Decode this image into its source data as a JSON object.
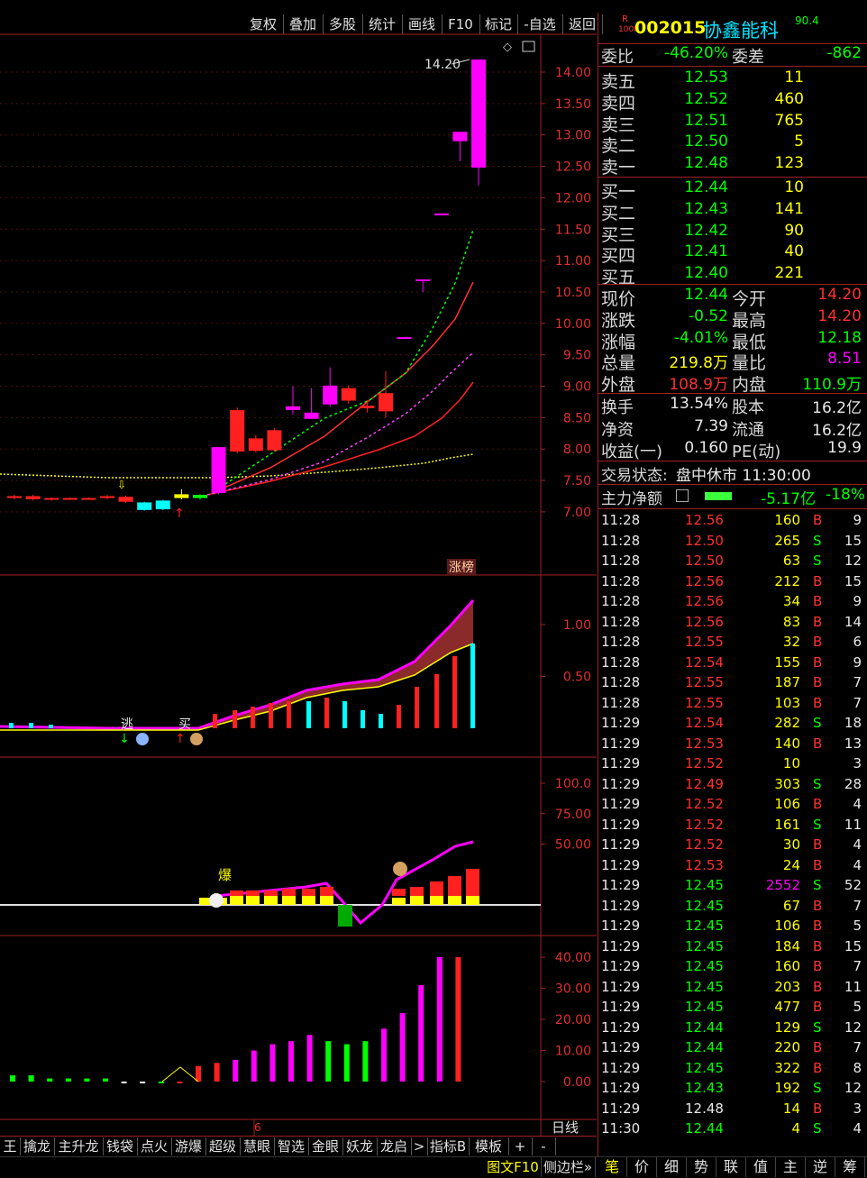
{
  "toolbar": {
    "buttons": [
      "复权",
      "叠加",
      "多股",
      "统计",
      "画线",
      "F10",
      "标记",
      "-自选",
      "返回"
    ]
  },
  "stock": {
    "badge_top": "R",
    "badge_bottom": "1000",
    "code": "002015",
    "name": "协鑫能科",
    "score": "90.4"
  },
  "weibi": {
    "label1": "委比",
    "val1": "-46.20%",
    "label2": "委差",
    "val2": "-862"
  },
  "sell": [
    {
      "label": "卖五",
      "price": "12.53",
      "vol": "11"
    },
    {
      "label": "卖四",
      "price": "12.52",
      "vol": "460"
    },
    {
      "label": "卖三",
      "price": "12.51",
      "vol": "765"
    },
    {
      "label": "卖二",
      "price": "12.50",
      "vol": "5"
    },
    {
      "label": "卖一",
      "price": "12.48",
      "vol": "123"
    }
  ],
  "buy": [
    {
      "label": "买一",
      "price": "12.44",
      "vol": "10"
    },
    {
      "label": "买二",
      "price": "12.43",
      "vol": "141"
    },
    {
      "label": "买三",
      "price": "12.42",
      "vol": "90"
    },
    {
      "label": "买四",
      "price": "12.41",
      "vol": "40"
    },
    {
      "label": "买五",
      "price": "12.40",
      "vol": "221"
    }
  ],
  "stats": [
    {
      "l1": "现价",
      "v1": "12.44",
      "c1": "#00ff00",
      "l2": "今开",
      "v2": "14.20",
      "c2": "#ff3030"
    },
    {
      "l1": "涨跌",
      "v1": "-0.52",
      "c1": "#00ff00",
      "l2": "最高",
      "v2": "14.20",
      "c2": "#ff3030"
    },
    {
      "l1": "涨幅",
      "v1": "-4.01%",
      "c1": "#00ff00",
      "l2": "最低",
      "v2": "12.18",
      "c2": "#00ff00"
    },
    {
      "l1": "总量",
      "v1": "219.8万",
      "c1": "#ffff00",
      "l2": "量比",
      "v2": "8.51",
      "c2": "#ff00ff"
    },
    {
      "l1": "外盘",
      "v1": "108.9万",
      "c1": "#ff3030",
      "l2": "内盘",
      "v2": "110.9万",
      "c2": "#00ff00"
    }
  ],
  "stats2": [
    {
      "l1": "换手",
      "v1": "13.54%",
      "l2": "股本",
      "v2": "16.2亿"
    },
    {
      "l1": "净资",
      "v1": "7.39",
      "l2": "流通",
      "v2": "16.2亿"
    },
    {
      "l1": "收益(一)",
      "v1": "0.160",
      "l2": "PE(动)",
      "v2": "19.9"
    }
  ],
  "trade_status": {
    "label": "交易状态:",
    "value": "盘中休市 11:30:00"
  },
  "main_net": {
    "label": "主力净额",
    "value": "-5.17亿",
    "pct": "-18%"
  },
  "ticks": [
    [
      "11:28",
      "12.56",
      "160",
      "B",
      "9"
    ],
    [
      "11:28",
      "12.50",
      "265",
      "S",
      "15"
    ],
    [
      "11:28",
      "12.50",
      "63",
      "S",
      "12"
    ],
    [
      "11:28",
      "12.56",
      "212",
      "B",
      "15"
    ],
    [
      "11:28",
      "12.56",
      "34",
      "B",
      "9"
    ],
    [
      "11:28",
      "12.56",
      "83",
      "B",
      "14"
    ],
    [
      "11:28",
      "12.55",
      "32",
      "B",
      "6"
    ],
    [
      "11:28",
      "12.54",
      "155",
      "B",
      "9"
    ],
    [
      "11:28",
      "12.55",
      "187",
      "B",
      "7"
    ],
    [
      "11:28",
      "12.55",
      "103",
      "B",
      "7"
    ],
    [
      "11:29",
      "12.54",
      "282",
      "S",
      "18"
    ],
    [
      "11:29",
      "12.53",
      "140",
      "B",
      "13"
    ],
    [
      "11:29",
      "12.52",
      "10",
      "",
      "3"
    ],
    [
      "11:29",
      "12.49",
      "303",
      "S",
      "28"
    ],
    [
      "11:29",
      "12.52",
      "106",
      "B",
      "4"
    ],
    [
      "11:29",
      "12.52",
      "161",
      "S",
      "11"
    ],
    [
      "11:29",
      "12.52",
      "30",
      "B",
      "4"
    ],
    [
      "11:29",
      "12.53",
      "24",
      "B",
      "4"
    ],
    [
      "11:29",
      "12.45",
      "2552",
      "S",
      "52"
    ],
    [
      "11:29",
      "12.45",
      "67",
      "B",
      "7"
    ],
    [
      "11:29",
      "12.45",
      "106",
      "B",
      "5"
    ],
    [
      "11:29",
      "12.45",
      "184",
      "B",
      "15"
    ],
    [
      "11:29",
      "12.45",
      "160",
      "B",
      "7"
    ],
    [
      "11:29",
      "12.45",
      "203",
      "B",
      "11"
    ],
    [
      "11:29",
      "12.45",
      "477",
      "B",
      "5"
    ],
    [
      "11:29",
      "12.44",
      "129",
      "S",
      "12"
    ],
    [
      "11:29",
      "12.44",
      "220",
      "B",
      "7"
    ],
    [
      "11:29",
      "12.45",
      "322",
      "B",
      "8"
    ],
    [
      "11:29",
      "12.43",
      "192",
      "S",
      "12"
    ],
    [
      "11:29",
      "12.48",
      "14",
      "B",
      "3"
    ],
    [
      "11:30",
      "12.44",
      "4",
      "S",
      "4"
    ]
  ],
  "bottom_tabs": [
    "王",
    "擒龙",
    "主升龙",
    "钱袋",
    "点火",
    "游爆",
    "超级",
    "慧眼",
    "智选",
    "金眼",
    "妖龙",
    "龙启",
    ">",
    "指标B",
    "模板",
    "+",
    "-"
  ],
  "footer_left": [
    "图文F10",
    "侧边栏»"
  ],
  "footer_right": [
    "笔",
    "价",
    "细",
    "势",
    "联",
    "值",
    "主",
    "逆",
    "筹"
  ],
  "chart_labels": {
    "price_axis": [
      "14.00",
      "13.50",
      "13.00",
      "12.50",
      "12.00",
      "11.50",
      "11.00",
      "10.50",
      "10.00",
      "9.50",
      "9.00",
      "8.50",
      "8.00",
      "7.50",
      "7.00"
    ],
    "ind1_axis": [
      "1.00",
      "0.50"
    ],
    "ind2_axis": [
      "100.0",
      "75.00",
      "50.00"
    ],
    "ind3_axis": [
      "40.00",
      "30.00",
      "20.00",
      "10.00",
      "0.00"
    ],
    "high_marker": "14.20",
    "zhangbang": "涨榜",
    "tao": "逃",
    "mai": "买",
    "bao": "爆",
    "x_label": "6",
    "period": "日线"
  },
  "chart_data": [
    {
      "type": "candlestick",
      "ylim": [
        6.75,
        14.3
      ],
      "candles": [
        {
          "o": 7.22,
          "c": 7.25,
          "h": 7.27,
          "l": 7.2,
          "color": "red"
        },
        {
          "o": 7.25,
          "c": 7.2,
          "h": 7.27,
          "l": 7.18,
          "color": "red"
        },
        {
          "o": 7.22,
          "c": 7.2,
          "h": 7.23,
          "l": 7.18,
          "color": "red"
        },
        {
          "o": 7.22,
          "c": 7.2,
          "h": 7.23,
          "l": 7.19,
          "color": "red"
        },
        {
          "o": 7.22,
          "c": 7.21,
          "h": 7.23,
          "l": 7.19,
          "color": "red"
        },
        {
          "o": 7.25,
          "c": 7.22,
          "h": 7.27,
          "l": 7.2,
          "color": "red"
        },
        {
          "o": 7.24,
          "c": 7.16,
          "h": 7.26,
          "l": 7.14,
          "color": "red"
        },
        {
          "o": 7.15,
          "c": 7.03,
          "h": 7.16,
          "l": 7.02,
          "color": "cyan"
        },
        {
          "o": 7.18,
          "c": 7.04,
          "h": 7.19,
          "l": 7.03,
          "color": "cyan"
        },
        {
          "o": 7.22,
          "c": 7.28,
          "h": 7.36,
          "l": 7.2,
          "color": "yellow"
        },
        {
          "o": 7.22,
          "c": 7.27,
          "h": 7.28,
          "l": 7.2,
          "color": "green"
        },
        {
          "o": 7.3,
          "c": 8.03,
          "h": 8.03,
          "l": 7.28,
          "color": "magenta"
        },
        {
          "o": 8.62,
          "c": 7.96,
          "h": 8.66,
          "l": 7.93,
          "color": "red"
        },
        {
          "o": 8.17,
          "c": 7.97,
          "h": 8.22,
          "l": 7.95,
          "color": "red"
        },
        {
          "o": 8.3,
          "c": 7.98,
          "h": 8.33,
          "l": 7.96,
          "color": "red"
        },
        {
          "o": 8.62,
          "c": 8.68,
          "h": 9.0,
          "l": 8.55,
          "color": "magenta"
        },
        {
          "o": 8.48,
          "c": 8.58,
          "h": 8.97,
          "l": 8.5,
          "color": "magenta"
        },
        {
          "o": 8.71,
          "c": 9.01,
          "h": 9.3,
          "l": 8.67,
          "color": "magenta"
        },
        {
          "o": 8.97,
          "c": 8.77,
          "h": 9.02,
          "l": 8.72,
          "color": "red"
        },
        {
          "o": 8.69,
          "c": 8.65,
          "h": 8.78,
          "l": 8.58,
          "color": "red"
        },
        {
          "o": 8.89,
          "c": 8.6,
          "h": 9.24,
          "l": 8.5,
          "color": "red"
        },
        {
          "o": 9.78,
          "c": 9.78,
          "h": 9.78,
          "l": 9.78,
          "color": "magenta"
        },
        {
          "o": 10.7,
          "c": 10.7,
          "h": 10.7,
          "l": 10.5,
          "color": "magenta"
        },
        {
          "o": 11.75,
          "c": 11.75,
          "h": 11.75,
          "l": 11.75,
          "color": "magenta"
        },
        {
          "o": 12.9,
          "c": 13.05,
          "h": 13.05,
          "l": 12.58,
          "color": "magenta"
        },
        {
          "o": 12.48,
          "c": 14.2,
          "h": 14.2,
          "l": 12.2,
          "color": "magenta"
        }
      ]
    },
    {
      "type": "bar",
      "title": "",
      "ylim": [
        0,
        40
      ],
      "values": [
        2,
        2,
        1,
        1,
        1,
        1,
        -0.3,
        -0.3,
        0,
        0,
        5,
        6,
        7,
        10,
        12,
        13,
        15,
        13,
        12,
        13,
        17,
        22,
        31,
        40,
        40
      ],
      "colors": [
        "green",
        "green",
        "green",
        "green",
        "green",
        "green",
        "white",
        "white",
        "green",
        "red",
        "red",
        "red",
        "magenta",
        "magenta",
        "magenta",
        "magenta",
        "magenta",
        "green",
        "green",
        "green",
        "magenta",
        "magenta",
        "magenta",
        "magenta",
        "red"
      ]
    }
  ]
}
